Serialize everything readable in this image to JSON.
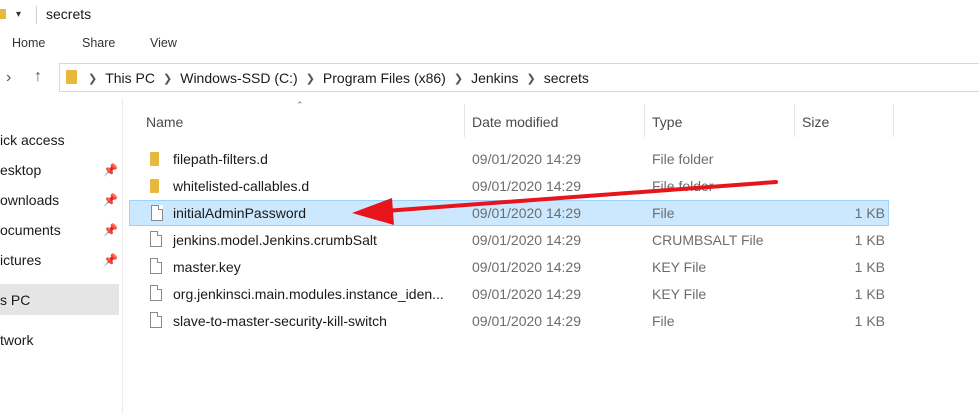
{
  "window": {
    "title": "secrets"
  },
  "ribbon": {
    "tabs": [
      "Home",
      "Share",
      "View"
    ]
  },
  "address": {
    "crumbs": [
      "This PC",
      "Windows-SSD (C:)",
      "Program Files (x86)",
      "Jenkins",
      "secrets"
    ]
  },
  "sidebar": {
    "items": [
      {
        "label": "ick access",
        "pinned": false
      },
      {
        "label": "esktop",
        "pinned": true
      },
      {
        "label": "ownloads",
        "pinned": true
      },
      {
        "label": "ocuments",
        "pinned": true
      },
      {
        "label": "ictures",
        "pinned": true
      },
      {
        "label": "s PC",
        "pinned": false,
        "selected": true
      },
      {
        "label": "twork",
        "pinned": false
      }
    ]
  },
  "columns": {
    "name": "Name",
    "date": "Date modified",
    "type": "Type",
    "size": "Size"
  },
  "files": [
    {
      "name": "filepath-filters.d",
      "date": "09/01/2020 14:29",
      "type": "File folder",
      "size": "",
      "kind": "folder"
    },
    {
      "name": "whitelisted-callables.d",
      "date": "09/01/2020 14:29",
      "type": "File folder",
      "size": "",
      "kind": "folder"
    },
    {
      "name": "initialAdminPassword",
      "date": "09/01/2020 14:29",
      "type": "File",
      "size": "1 KB",
      "kind": "file",
      "selected": true
    },
    {
      "name": "jenkins.model.Jenkins.crumbSalt",
      "date": "09/01/2020 14:29",
      "type": "CRUMBSALT File",
      "size": "1 KB",
      "kind": "file"
    },
    {
      "name": "master.key",
      "date": "09/01/2020 14:29",
      "type": "KEY File",
      "size": "1 KB",
      "kind": "file"
    },
    {
      "name": "org.jenkinsci.main.modules.instance_iden...",
      "date": "09/01/2020 14:29",
      "type": "KEY File",
      "size": "1 KB",
      "kind": "file"
    },
    {
      "name": "slave-to-master-security-kill-switch",
      "date": "09/01/2020 14:29",
      "type": "File",
      "size": "1 KB",
      "kind": "file"
    }
  ],
  "annotation": {
    "color": "#e8141b"
  }
}
